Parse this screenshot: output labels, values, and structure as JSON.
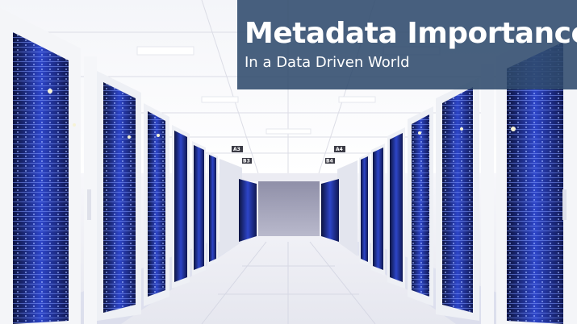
{
  "banner": {
    "title": "Metadata Importance",
    "subtitle": "In a Data Driven World"
  },
  "scene": {
    "description_icon": "server-rack-corridor",
    "aisle_signs": [
      "A3",
      "A4",
      "B3",
      "B4"
    ]
  },
  "colors": {
    "banner": "#2F4A6C",
    "server_glow": "#3B5BFF",
    "rack_frame": "#F2F3F7",
    "floor": "#E9EAF2"
  }
}
